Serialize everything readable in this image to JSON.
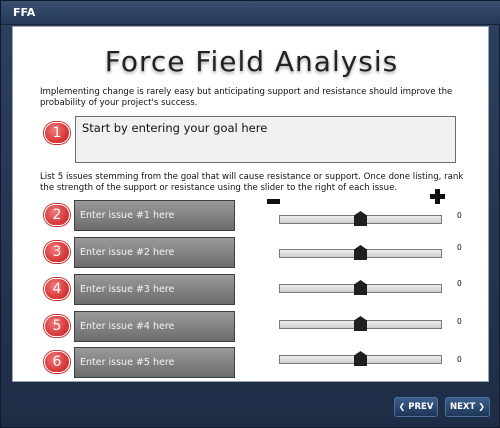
{
  "window": {
    "title": "FFA"
  },
  "page": {
    "title": "Force Field Analysis",
    "intro": "Implementing change is rarely easy but anticipating support and resistance should improve the probability of your project's success.",
    "goal": {
      "number": "1",
      "placeholder": "Start by entering your goal here"
    },
    "list_instructions": "List 5 issues stemming from the goal that will cause resistance or support. Once done listing, rank the strength of the support or resistance using the slider to the right of each issue.",
    "slider_scale": {
      "min_icon": "minus-icon",
      "max_icon": "plus-icon"
    },
    "issues": [
      {
        "number": "2",
        "placeholder": "Enter issue #1 here",
        "value": "0",
        "level": 0.5
      },
      {
        "number": "3",
        "placeholder": "Enter issue #2 here",
        "value": "0",
        "level": 0.5
      },
      {
        "number": "4",
        "placeholder": "Enter issue #3 here",
        "value": "0",
        "level": 0.5
      },
      {
        "number": "5",
        "placeholder": "Enter issue #4 here",
        "value": "0",
        "level": 0.5
      },
      {
        "number": "6",
        "placeholder": "Enter issue #5 here",
        "value": "0",
        "level": 0.5
      }
    ]
  },
  "footer": {
    "prev_label": "PREV",
    "next_label": "NEXT"
  },
  "colors": {
    "badge": "#d93a3a",
    "frame": "#22344f",
    "issue_box": "#7d7d7d"
  }
}
